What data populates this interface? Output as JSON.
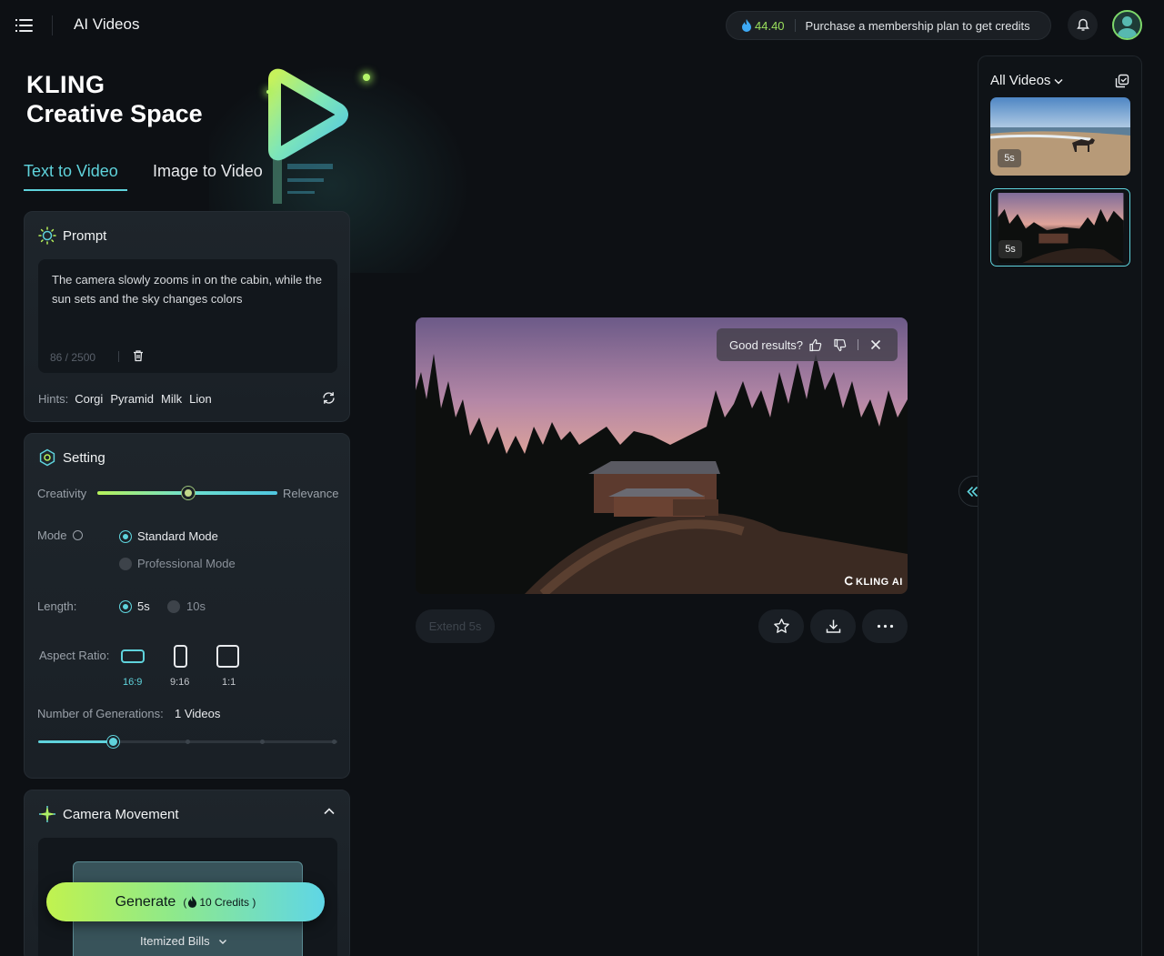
{
  "header": {
    "app_title": "AI Videos",
    "credits": "44.40",
    "purchase_text": "Purchase a membership plan to get credits",
    "accent_color": "#9be15d"
  },
  "hero": {
    "brand_line1": "KLING",
    "brand_line2": "Creative Space",
    "tabs": [
      {
        "label": "Text to Video",
        "active": true
      },
      {
        "label": "Image to Video",
        "active": false
      }
    ]
  },
  "prompt": {
    "title": "Prompt",
    "text": "The camera slowly zooms in on the cabin, while the sun sets and the sky changes colors",
    "counter": "86 / 2500",
    "hints_label": "Hints:",
    "hints": [
      "Corgi",
      "Pyramid",
      "Milk",
      "Lion"
    ]
  },
  "setting": {
    "title": "Setting",
    "creativity_label": "Creativity",
    "relevance_label": "Relevance",
    "creativity_value": 0.5,
    "mode_label": "Mode",
    "modes": [
      {
        "label": "Standard Mode",
        "selected": true
      },
      {
        "label": "Professional Mode",
        "selected": false
      }
    ],
    "length_label": "Length:",
    "lengths": [
      {
        "label": "5s",
        "selected": true
      },
      {
        "label": "10s",
        "selected": false
      }
    ],
    "aspect_label": "Aspect Ratio:",
    "aspects": [
      {
        "label": "16:9",
        "selected": true
      },
      {
        "label": "9:16",
        "selected": false
      },
      {
        "label": "1:1",
        "selected": false
      }
    ],
    "generations_label": "Number of Generations:",
    "generations_value": "1 Videos",
    "generations_level": 0.25
  },
  "camera": {
    "title": "Camera Movement"
  },
  "generate": {
    "label": "Generate",
    "credits": "10 Credits",
    "bills_label": "Itemized Bills"
  },
  "player": {
    "feedback_prompt": "Good results?",
    "watermark": "KLING AI",
    "extend_label": "Extend 5s",
    "actions": [
      "star-icon",
      "download-icon",
      "more-icon"
    ]
  },
  "sidebar": {
    "title": "All Videos",
    "items": [
      {
        "duration": "5s",
        "selected": false
      },
      {
        "duration": "5s",
        "selected": true
      }
    ]
  }
}
